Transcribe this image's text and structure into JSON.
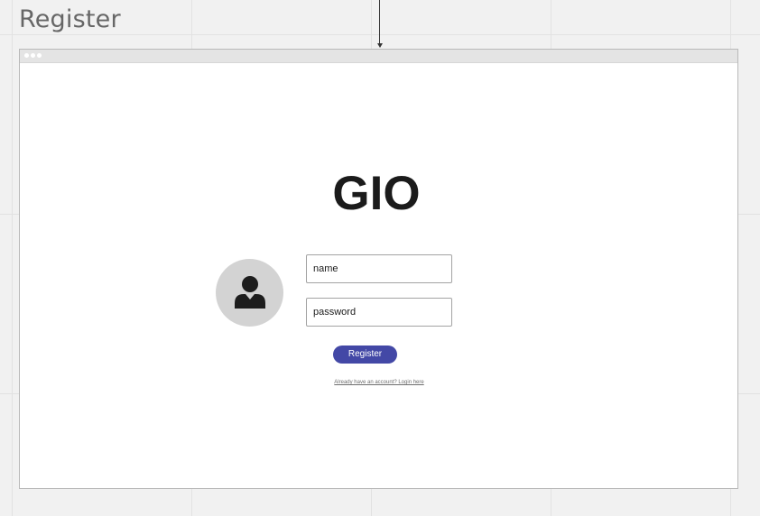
{
  "frame": {
    "title": "Register"
  },
  "window": {
    "titlebar_dots": 3
  },
  "form": {
    "logo_text": "GIO",
    "avatar_icon": "user-icon",
    "name_field": {
      "value": "name"
    },
    "password_field": {
      "value": "password"
    },
    "submit_label": "Register",
    "login_link_text": "Already have an account? Login here"
  },
  "colors": {
    "canvas_background": "#f1f1f1",
    "window_background": "#ffffff",
    "button_primary": "#4348a6",
    "avatar_background": "#d3d3d3",
    "text_dark": "#1b1b1b"
  }
}
